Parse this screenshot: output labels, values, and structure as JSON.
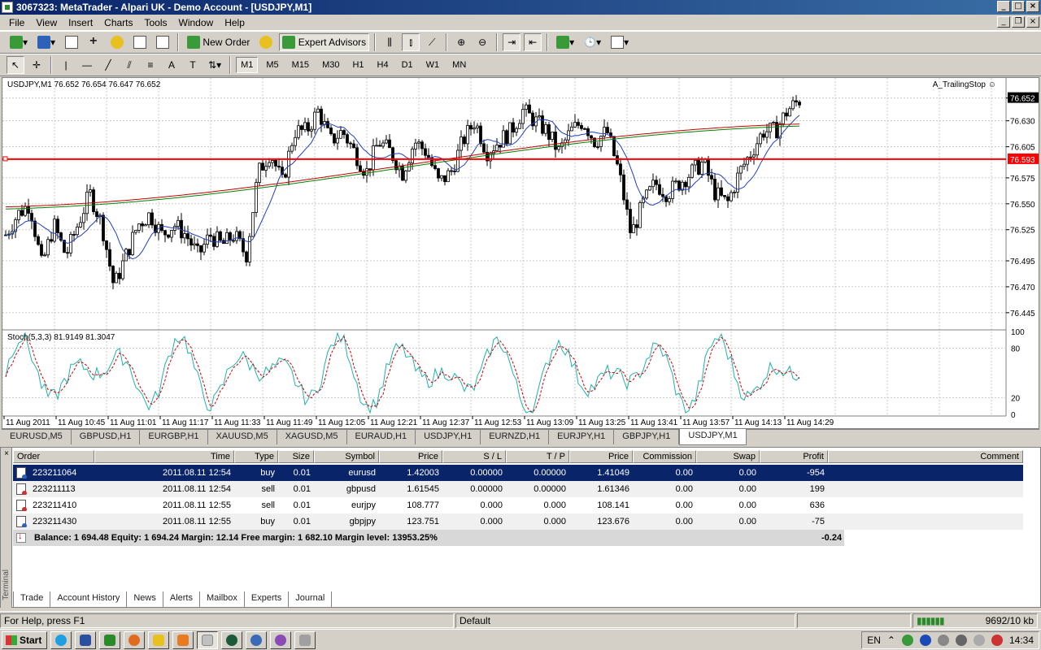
{
  "window": {
    "title": "3067323: MetaTrader - Alpari UK - Demo Account - [USDJPY,M1]"
  },
  "menu": [
    "File",
    "View",
    "Insert",
    "Charts",
    "Tools",
    "Window",
    "Help"
  ],
  "toolbar": {
    "new_order": "New Order",
    "expert_advisors": "Expert Advisors",
    "timeframes": [
      "M1",
      "M5",
      "M15",
      "M30",
      "H1",
      "H4",
      "D1",
      "W1",
      "MN"
    ],
    "active_timeframe": "M1"
  },
  "chart": {
    "header": "USDJPY,M1  76.652 76.654 76.647 76.652",
    "expert": "A_TrailingStop",
    "stoch_label": "Stoch(5,3,3) 81.9149 81.3047",
    "price_ticks": [
      "76.652",
      "76.630",
      "76.605",
      "76.575",
      "76.550",
      "76.525",
      "76.495",
      "76.470",
      "76.445"
    ],
    "current_price": "76.652",
    "line_price": "76.593",
    "stoch_ticks": [
      "100",
      "80",
      "20",
      "0"
    ],
    "time_ticks": [
      "11 Aug 2011",
      "11 Aug 10:45",
      "11 Aug 11:01",
      "11 Aug 11:17",
      "11 Aug 11:33",
      "11 Aug 11:49",
      "11 Aug 12:05",
      "11 Aug 12:21",
      "11 Aug 12:37",
      "11 Aug 12:53",
      "11 Aug 13:09",
      "11 Aug 13:25",
      "11 Aug 13:41",
      "11 Aug 13:57",
      "11 Aug 14:13",
      "11 Aug 14:29"
    ]
  },
  "chart_data": {
    "type": "candlestick",
    "symbol": "USDJPY",
    "timeframe": "M1",
    "ylim": [
      76.43,
      76.665
    ],
    "line_price": 76.593,
    "close_samples": [
      76.52,
      76.54,
      76.55,
      76.49,
      76.53,
      76.5,
      76.53,
      76.56,
      76.53,
      76.47,
      76.5,
      76.53,
      76.54,
      76.52,
      76.53,
      76.52,
      76.5,
      76.52,
      76.51,
      76.52,
      76.5,
      76.58,
      76.6,
      76.57,
      76.62,
      76.62,
      76.64,
      76.61,
      76.62,
      76.6,
      76.58,
      76.61,
      76.6,
      76.58,
      76.61,
      76.6,
      76.57,
      76.58,
      76.61,
      76.63,
      76.6,
      76.61,
      76.62,
      76.64,
      76.63,
      76.62,
      76.6,
      76.62,
      76.63,
      76.61,
      76.62,
      76.58,
      76.52,
      76.55,
      76.57,
      76.56,
      76.57,
      76.58,
      76.59,
      76.56,
      76.55,
      76.58,
      76.6,
      76.62,
      76.62,
      76.64,
      76.65
    ],
    "stoch_ylim": [
      0,
      100
    ]
  },
  "symbol_tabs": [
    "EURUSD,M5",
    "GBPUSD,H1",
    "EURGBP,H1",
    "XAUUSD,M5",
    "XAGUSD,M5",
    "EURAUD,H1",
    "USDJPY,H1",
    "EURNZD,H1",
    "EURJPY,H1",
    "GBPJPY,H1",
    "USDJPY,M1"
  ],
  "active_symbol_tab": "USDJPY,M1",
  "trade": {
    "columns": [
      "Order",
      "Time",
      "Type",
      "Size",
      "Symbol",
      "Price",
      "S / L",
      "T / P",
      "Price",
      "Commission",
      "Swap",
      "Profit",
      "Comment"
    ],
    "rows": [
      {
        "order": "223211064",
        "time": "2011.08.11 12:54",
        "type": "buy",
        "size": "0.01",
        "symbol": "eurusd",
        "price": "1.42003",
        "sl": "0.00000",
        "tp": "0.00000",
        "cur": "1.41049",
        "commission": "0.00",
        "swap": "0.00",
        "profit": "-954"
      },
      {
        "order": "223211113",
        "time": "2011.08.11 12:54",
        "type": "sell",
        "size": "0.01",
        "symbol": "gbpusd",
        "price": "1.61545",
        "sl": "0.00000",
        "tp": "0.00000",
        "cur": "1.61346",
        "commission": "0.00",
        "swap": "0.00",
        "profit": "199"
      },
      {
        "order": "223211410",
        "time": "2011.08.11 12:55",
        "type": "sell",
        "size": "0.01",
        "symbol": "eurjpy",
        "price": "108.777",
        "sl": "0.000",
        "tp": "0.000",
        "cur": "108.141",
        "commission": "0.00",
        "swap": "0.00",
        "profit": "636"
      },
      {
        "order": "223211430",
        "time": "2011.08.11 12:55",
        "type": "buy",
        "size": "0.01",
        "symbol": "gbpjpy",
        "price": "123.751",
        "sl": "0.000",
        "tp": "0.000",
        "cur": "123.676",
        "commission": "0.00",
        "swap": "0.00",
        "profit": "-75"
      }
    ],
    "balance_line": "Balance: 1 694.48  Equity: 1 694.24  Margin: 12.14  Free margin: 1 682.10  Margin level: 13953.25%",
    "total_profit": "-0.24"
  },
  "terminal": {
    "side_label": "Terminal",
    "tabs": [
      "Trade",
      "Account History",
      "News",
      "Alerts",
      "Mailbox",
      "Experts",
      "Journal"
    ],
    "active_tab": "Trade"
  },
  "status": {
    "help": "For Help, press F1",
    "profile": "Default",
    "traffic": "9692/10 kb"
  },
  "taskbar": {
    "start": "Start",
    "lang": "EN",
    "clock": "14:34"
  },
  "colors": {
    "title_bar": "#0a246a",
    "line_red": "#ff0000",
    "stoch_main": "#20b2aa",
    "stoch_signal": "#cc0000",
    "ma_blue": "#2040c0",
    "ma_green": "#008000",
    "ma_red": "#c00000",
    "selected_row": "#0a246a"
  }
}
